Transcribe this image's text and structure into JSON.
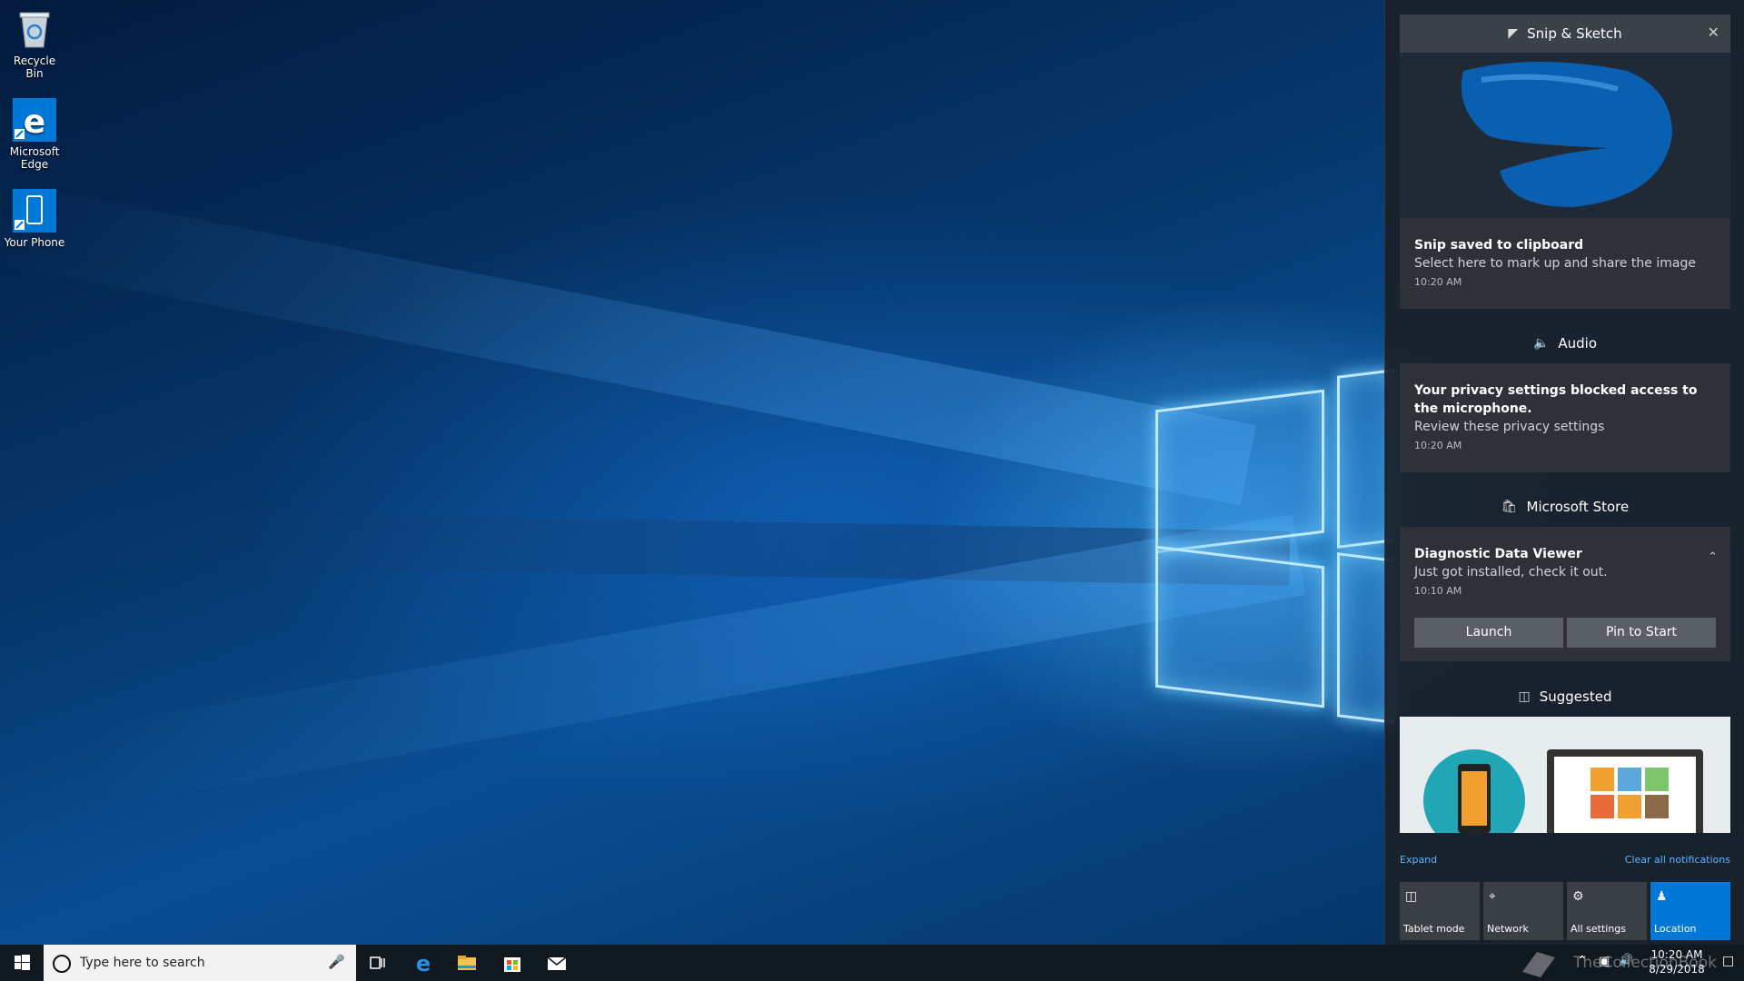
{
  "desktop": {
    "icons": [
      {
        "label": "Recycle Bin",
        "icon": "recycle-bin-icon"
      },
      {
        "label": "Microsoft Edge",
        "icon": "edge-icon"
      },
      {
        "label": "Your Phone",
        "icon": "phone-icon"
      }
    ]
  },
  "action_center": {
    "snip": {
      "app_name": "Snip & Sketch",
      "title": "Snip saved to clipboard",
      "body": "Select here to mark up and share the image",
      "time": "10:20 AM"
    },
    "audio": {
      "app_name": "Audio",
      "title": "Your privacy settings blocked access to the microphone.",
      "body": "Review these privacy settings",
      "time": "10:20 AM"
    },
    "store": {
      "app_name": "Microsoft Store",
      "title": "Diagnostic Data Viewer",
      "body": "Just got installed, check it out.",
      "time": "10:10 AM",
      "launch_label": "Launch",
      "pin_label": "Pin to Start"
    },
    "suggested": {
      "app_name": "Suggested"
    },
    "expand_label": "Expand",
    "clear_all_label": "Clear all notifications",
    "quick_actions": [
      {
        "label": "Tablet mode",
        "icon": "tablet-mode-icon",
        "active": false
      },
      {
        "label": "Network",
        "icon": "network-icon",
        "active": false
      },
      {
        "label": "All settings",
        "icon": "gear-icon",
        "active": false
      },
      {
        "label": "Location",
        "icon": "location-icon",
        "active": true
      }
    ]
  },
  "taskbar": {
    "search_placeholder": "Type here to search",
    "clock_time": "10:20 AM",
    "clock_date": "8/29/2018",
    "watermark": "TheCollectionBook"
  },
  "colors": {
    "accent": "#0078d7",
    "link": "#5fb4ff",
    "panel": "#1a2028"
  }
}
